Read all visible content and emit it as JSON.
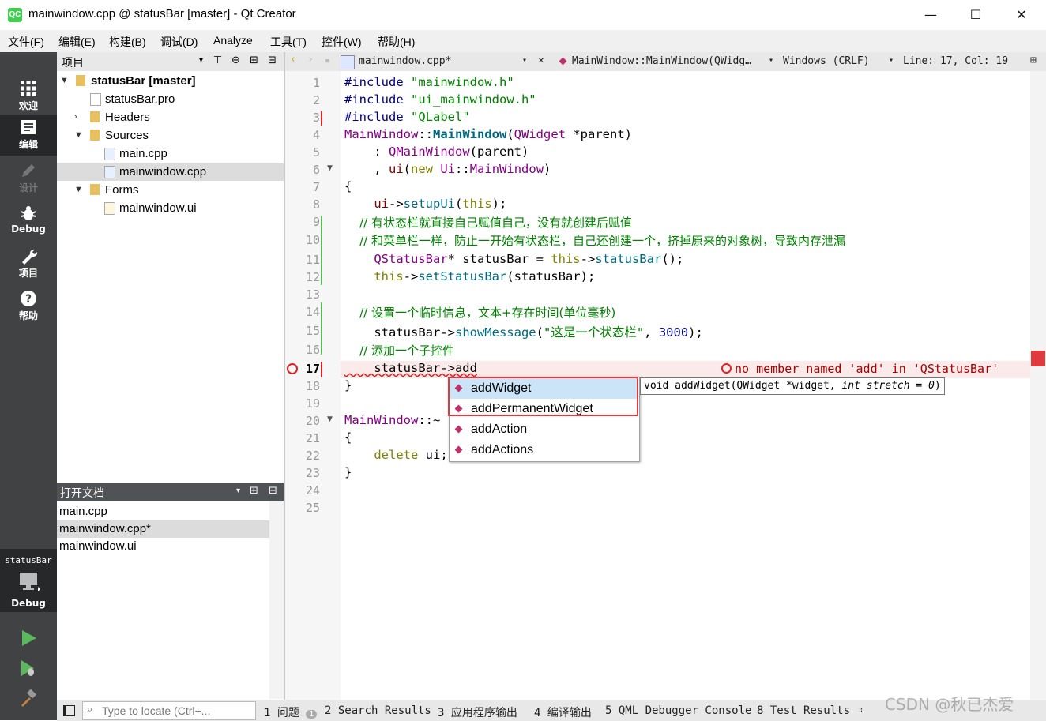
{
  "window": {
    "title": "mainwindow.cpp @ statusBar [master] - Qt Creator",
    "icon_text": "QC",
    "minimize": "—",
    "maximize": "☐",
    "close": "✕"
  },
  "menu": [
    "文件(F)",
    "编辑(E)",
    "构建(B)",
    "调试(D)",
    "Analyze",
    "工具(T)",
    "控件(W)",
    "帮助(H)"
  ],
  "modes": [
    {
      "label": "欢迎",
      "icon": "grid-icon"
    },
    {
      "label": "编辑",
      "icon": "edit-icon"
    },
    {
      "label": "设计",
      "icon": "pencil-icon"
    },
    {
      "label": "Debug",
      "icon": "bug-icon"
    },
    {
      "label": "项目",
      "icon": "wrench-icon"
    },
    {
      "label": "帮助",
      "icon": "help-icon"
    }
  ],
  "kit": {
    "project": "statusBar",
    "mode": "Debug"
  },
  "project_panel": {
    "title": "项目",
    "tree": [
      {
        "label": "statusBar [master]",
        "bold": true
      },
      {
        "label": "statusBar.pro"
      },
      {
        "label": "Headers"
      },
      {
        "label": "Sources"
      },
      {
        "label": "main.cpp"
      },
      {
        "label": "mainwindow.cpp"
      },
      {
        "label": "Forms"
      },
      {
        "label": "mainwindow.ui"
      }
    ]
  },
  "open_docs": {
    "title": "打开文档",
    "items": [
      "main.cpp",
      "mainwindow.cpp*",
      "mainwindow.ui"
    ]
  },
  "editor_toolbar": {
    "file": "mainwindow.cpp*",
    "symbol": "MainWindow::MainWindow(QWidg…",
    "line_ending": "Windows (CRLF)",
    "position": "Line: 17, Col: 19"
  },
  "code": {
    "line_numbers": [
      "1",
      "2",
      "3",
      "4",
      "5",
      "6",
      "7",
      "8",
      "9",
      "10",
      "11",
      "12",
      "13",
      "14",
      "15",
      "16",
      "17",
      "18",
      "19",
      "20",
      "21",
      "22",
      "23",
      "24",
      "25"
    ],
    "l1": [
      "#include ",
      "\"mainwindow.h\""
    ],
    "l2": [
      "#include ",
      "\"ui_mainwindow.h\""
    ],
    "l3": [
      "#include ",
      "\"QLabel\""
    ],
    "l4": [
      "MainWindow",
      "::",
      "MainWindow",
      "(",
      "QWidget",
      " *parent)"
    ],
    "l5": [
      "    : ",
      "QMainWindow",
      "(parent)"
    ],
    "l6": [
      "    , ",
      "ui",
      "(",
      "new",
      " ",
      "Ui",
      "::",
      "MainWindow",
      ")"
    ],
    "l7": "{",
    "l8": [
      "    ",
      "ui",
      "->",
      "setupUi",
      "(",
      "this",
      ");"
    ],
    "l9": "    // 有状态栏就直接自己赋值自己，没有就创建后赋值",
    "l10": "    // 和菜单栏一样，防止一开始有状态栏，自己还创建一个，挤掉原来的对象树，导致内存泄漏",
    "l11": [
      "    ",
      "QStatusBar",
      "* statusBar = ",
      "this",
      "->",
      "statusBar",
      "();"
    ],
    "l12": [
      "    ",
      "this",
      "->",
      "setStatusBar",
      "(statusBar);"
    ],
    "l14": "    // 设置一个临时信息，文本+存在时间(单位毫秒)",
    "l15": [
      "    statusBar->",
      "showMessage",
      "(",
      "\"这是一个状态栏\"",
      ", ",
      "3000",
      ");"
    ],
    "l16": "    // 添加一个子控件",
    "l17": "    statusBar->add",
    "l18": "}",
    "l20": [
      "MainWindow",
      "::~"
    ],
    "l21": "{",
    "l22": [
      "    ",
      "delete",
      " ui;"
    ],
    "l23": "}"
  },
  "error": "no member named 'add' in 'QStatusBar'",
  "completion": {
    "items": [
      "addWidget",
      "addPermanentWidget",
      "addAction",
      "addActions"
    ],
    "selected": 0,
    "tooltip_prefix": "void addWidget(QWidget *widget, ",
    "tooltip_italic": "int stretch = 0",
    "tooltip_suffix": ")"
  },
  "statusbar": {
    "locator_placeholder": "Type to locate (Ctrl+...",
    "tabs": [
      "1 问题",
      "2 Search Results",
      "3 应用程序输出",
      "4 编译输出",
      "5 QML Debugger Console",
      "8 Test Results"
    ],
    "issues_count": "1"
  },
  "watermark": "CSDN @秋已杰爱",
  "colors": {
    "modebar": "#404244",
    "error": "#e0393e",
    "selection": "#cce4f7"
  }
}
